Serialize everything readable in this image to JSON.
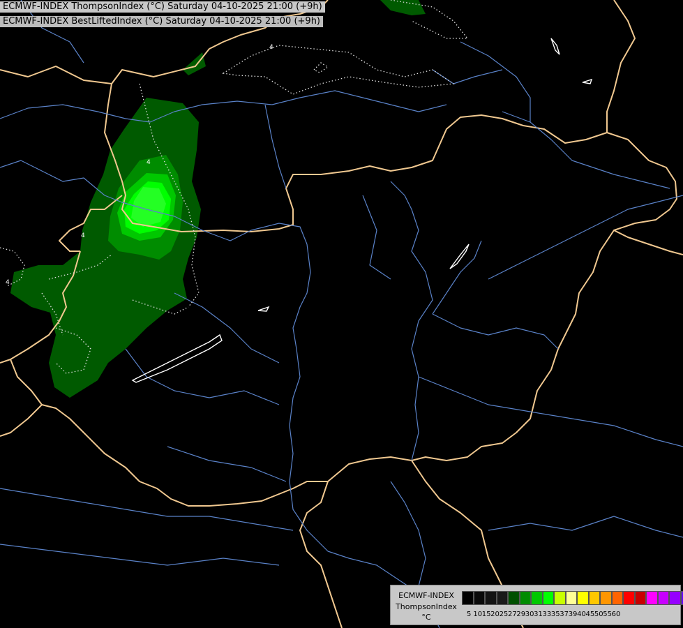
{
  "header": {
    "line1": "ECMWF-INDEX ThompsonIndex (°C) Saturday 04-10-2025 21:00 (+9h)",
    "line2": "ECMWF-INDEX BestLiftedIndex (°C) Saturday 04-10-2025 21:00 (+9h)"
  },
  "contour_labels": [
    "4",
    "4",
    "4",
    "4"
  ],
  "legend": {
    "title1": "ECMWF-INDEX",
    "title2": "ThompsonIndex",
    "unit": "°C",
    "colors": [
      "#000000",
      "#0a0a0a",
      "#141414",
      "#1a1a1a",
      "#005000",
      "#008c00",
      "#00c800",
      "#00ff00",
      "#c8ff00",
      "#ffff96",
      "#ffff00",
      "#ffc800",
      "#ff9600",
      "#ff6400",
      "#ff0000",
      "#c80000",
      "#ff00ff",
      "#c800ff",
      "#9600ff",
      "#6400ff",
      "#0000ff"
    ],
    "ticks": [
      "5",
      "10",
      "15",
      "20",
      "25",
      "27",
      "29",
      "30",
      "31",
      "33",
      "35",
      "37",
      "39",
      "40",
      "45",
      "50",
      "55",
      "60"
    ]
  }
}
